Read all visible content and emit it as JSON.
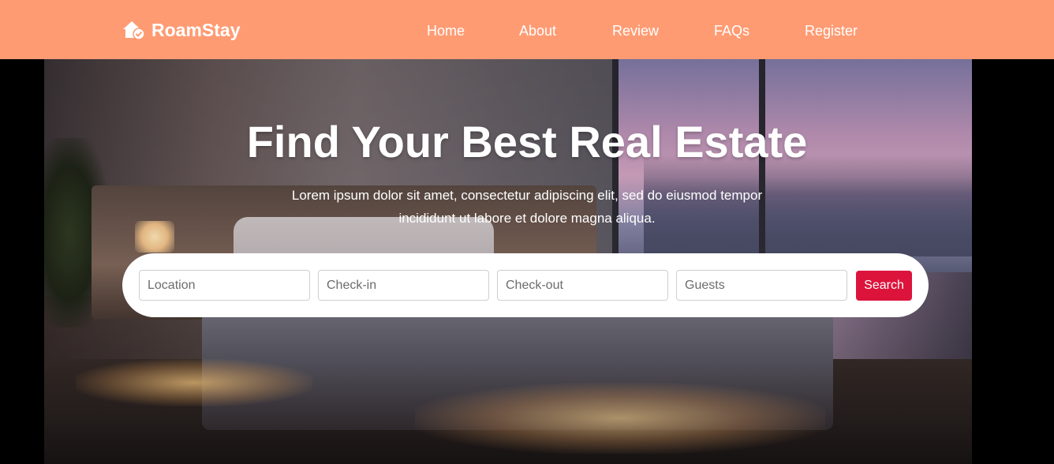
{
  "brand": {
    "name": "RoamStay",
    "icon": "house-check-icon"
  },
  "nav": {
    "items": [
      {
        "label": "Home"
      },
      {
        "label": "About"
      },
      {
        "label": "Review"
      },
      {
        "label": "FAQs"
      },
      {
        "label": "Register"
      }
    ]
  },
  "hero": {
    "title": "Find Your Best Real Estate",
    "subtitle": "Lorem ipsum dolor sit amet, consectetur adipiscing elit, sed do eiusmod tempor incididunt ut labore et dolore magna aliqua."
  },
  "search": {
    "location_placeholder": "Location",
    "checkin_placeholder": "Check-in",
    "checkout_placeholder": "Check-out",
    "guests_placeholder": "Guests",
    "button_label": "Search"
  },
  "colors": {
    "navbar": "#ff9b73",
    "search_button": "#dc143c",
    "text_light": "#ffffff"
  }
}
